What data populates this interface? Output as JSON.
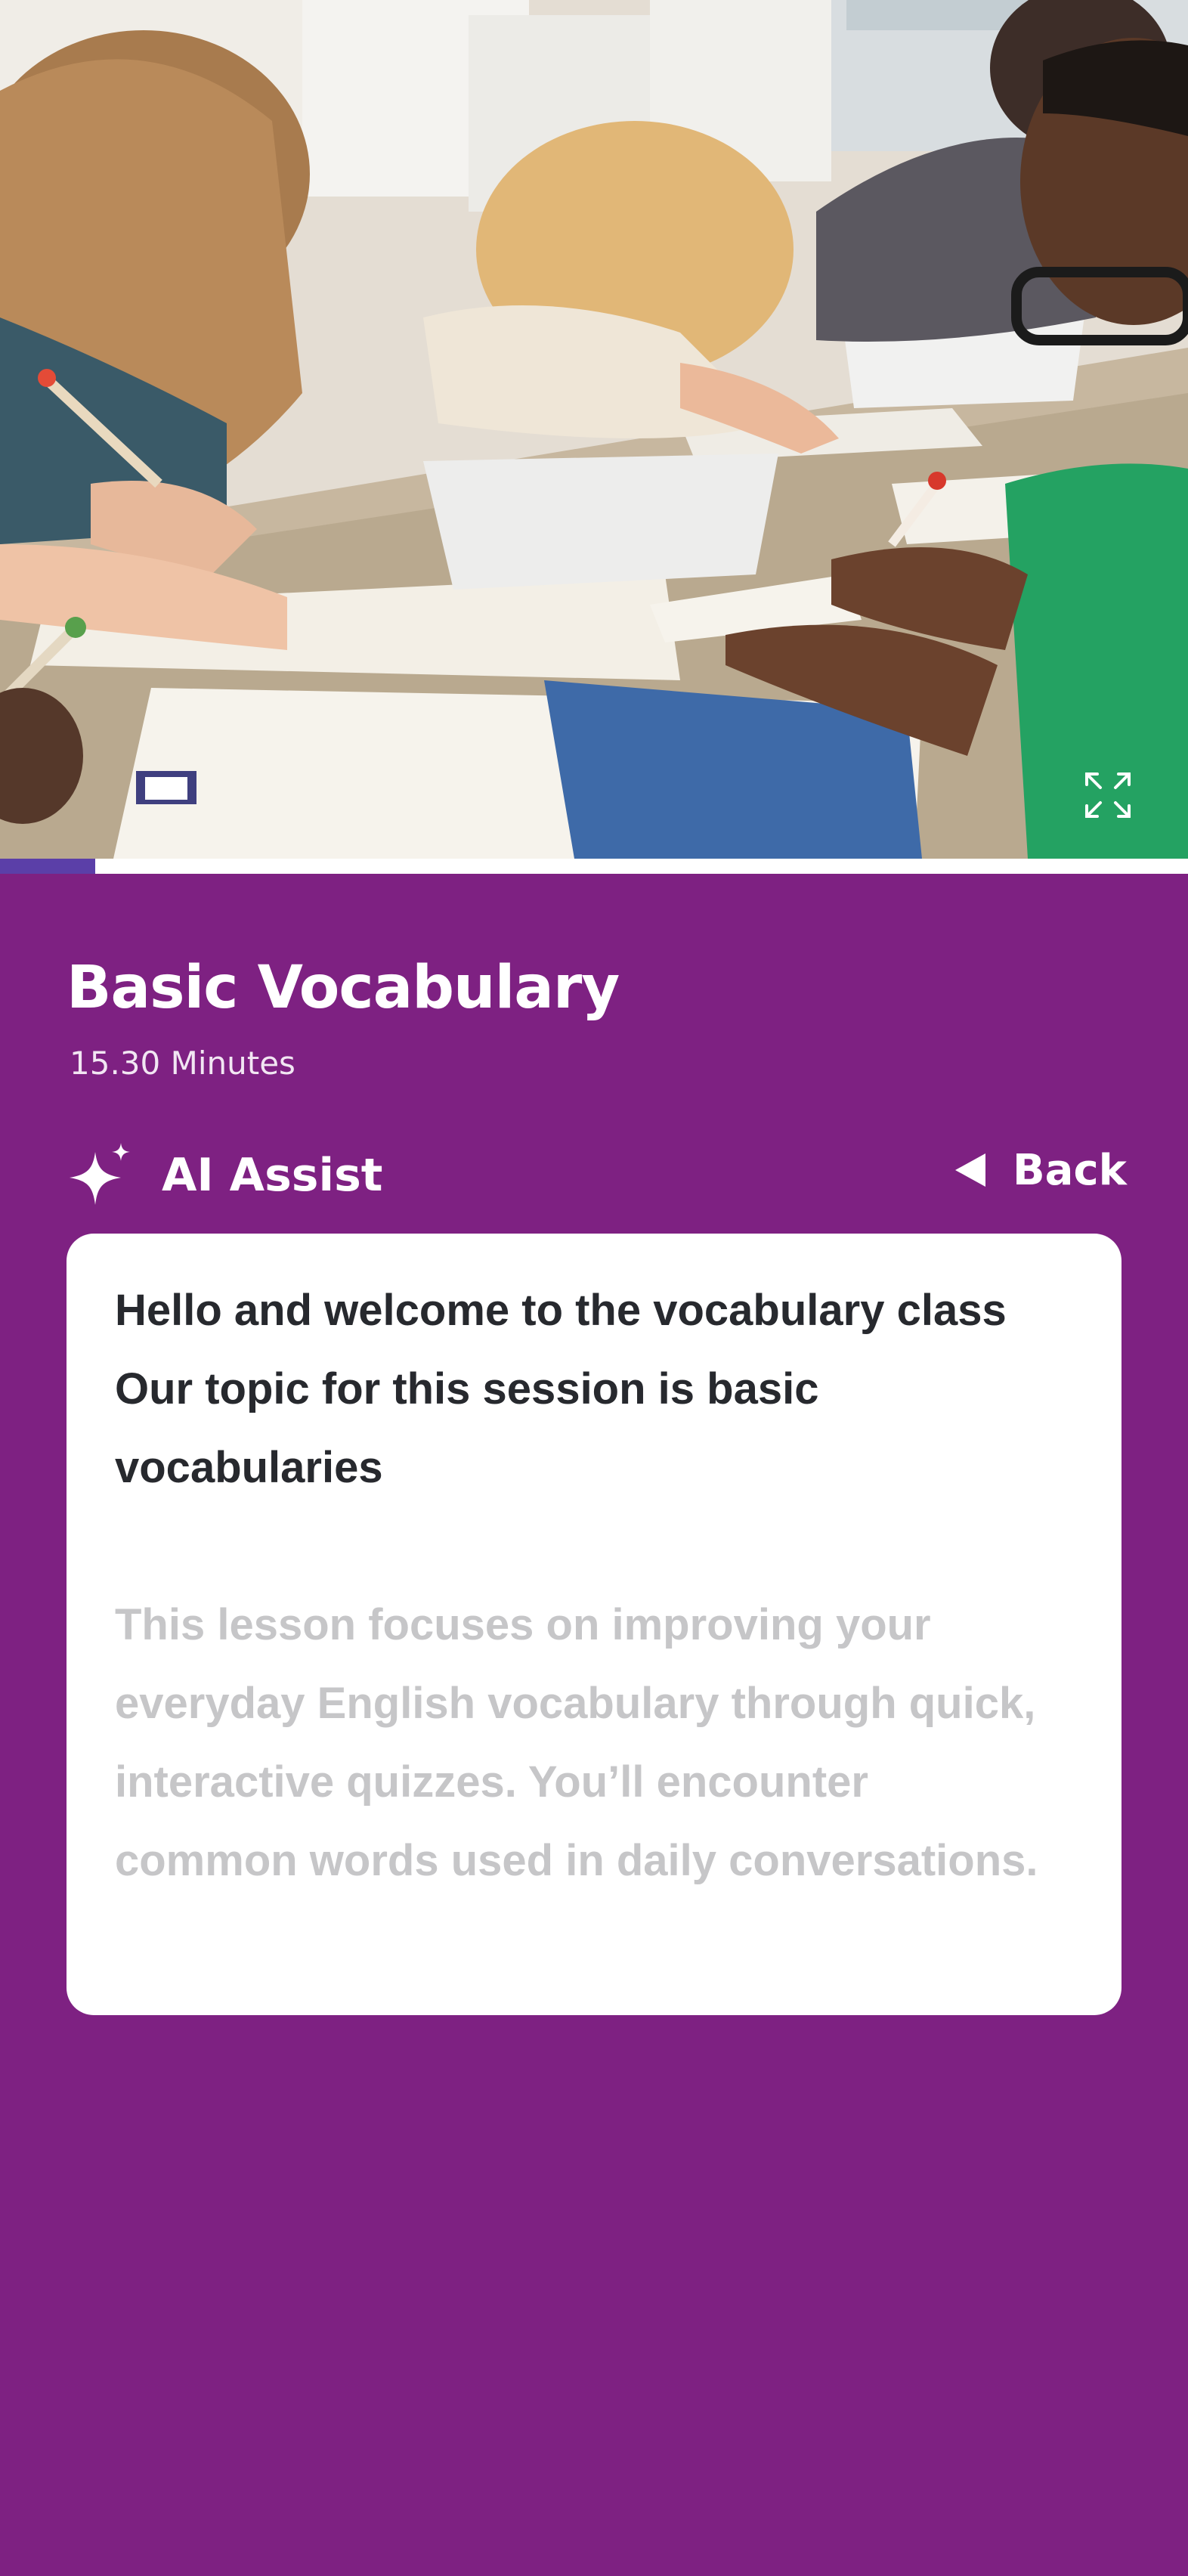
{
  "video": {
    "scene_description_icon": "classroom-photo",
    "progress_fraction": 0.08,
    "expand_icon": "expand-icon"
  },
  "lesson": {
    "title": "Basic Vocabulary",
    "duration": "15.30 Minutes"
  },
  "ai_assist": {
    "icon": "sparkle-icon",
    "label": "AI Assist"
  },
  "back": {
    "icon": "triangle-left-icon",
    "label": "Back"
  },
  "transcript": {
    "active_lines": [
      "Hello and welcome to the vocabulary class",
      "Our topic for this session is basic",
      "vocabularies"
    ],
    "upcoming_lines": [
      "This lesson focuses on improving your",
      "everyday English vocabulary through quick,",
      "interactive quizzes. You’ll encounter",
      "common words used in daily conversations."
    ]
  },
  "colors": {
    "background": "#7e2182",
    "progress": "#5b3fa8",
    "card": "#ffffff",
    "active_text": "#27292e",
    "upcoming_text": "#c6c6c8"
  }
}
